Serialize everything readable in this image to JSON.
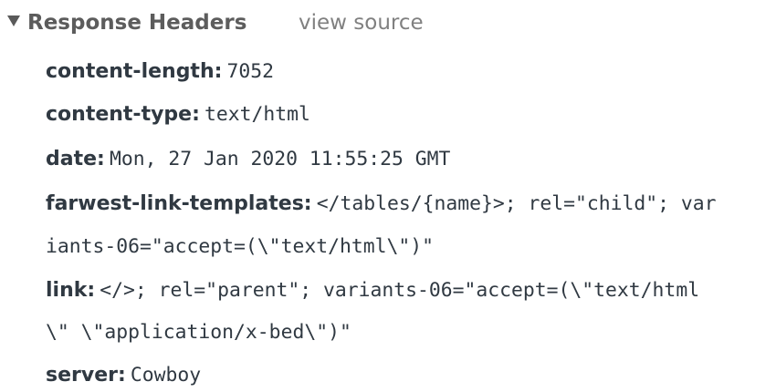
{
  "section": {
    "title": "Response Headers",
    "view_source_label": "view source"
  },
  "headers": [
    {
      "name": "content-length:",
      "value": "7052"
    },
    {
      "name": "content-type:",
      "value": "text/html"
    },
    {
      "name": "date:",
      "value": "Mon, 27 Jan 2020 11:55:25 GMT"
    },
    {
      "name": "farwest-link-templates:",
      "value": "</tables/{name}>; rel=\"child\"; var"
    },
    {
      "name": "",
      "value": "iants-06=\"accept=(\\\"text/html\\\")\""
    },
    {
      "name": "link:",
      "value": "</>; rel=\"parent\"; variants-06=\"accept=(\\\"text/html"
    },
    {
      "name": "",
      "value": "\\\" \\\"application/x-bed\\\")\""
    },
    {
      "name": "server:",
      "value": "Cowboy"
    }
  ]
}
